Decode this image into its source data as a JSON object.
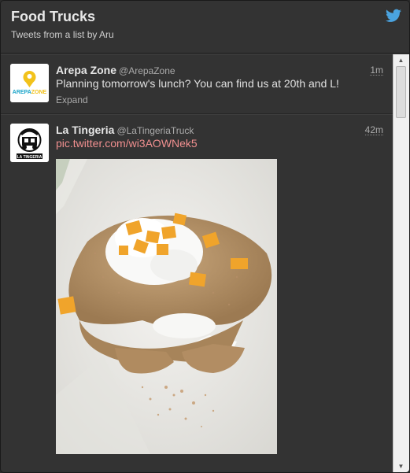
{
  "header": {
    "title": "Food Trucks",
    "subtitle": "Tweets from a list by Aru",
    "brand_icon": "twitter-bird-icon",
    "brand_color": "#4aa3df"
  },
  "tweets": [
    {
      "name": "Arepa Zone",
      "handle": "@ArepaZone",
      "time": "1m",
      "text": "Planning tomorrow's lunch? You can find us at 20th and L!",
      "expand": "Expand",
      "avatar_text": "AREPA ZONE"
    },
    {
      "name": "La Tingeria",
      "handle": "@LaTingeriaTruck",
      "time": "42m",
      "link": "pic.twitter.com/wi3AOWNek5",
      "avatar_text": "LA TINGERIA"
    }
  ],
  "scrollbar": {
    "up": "▲",
    "down": "▼"
  }
}
